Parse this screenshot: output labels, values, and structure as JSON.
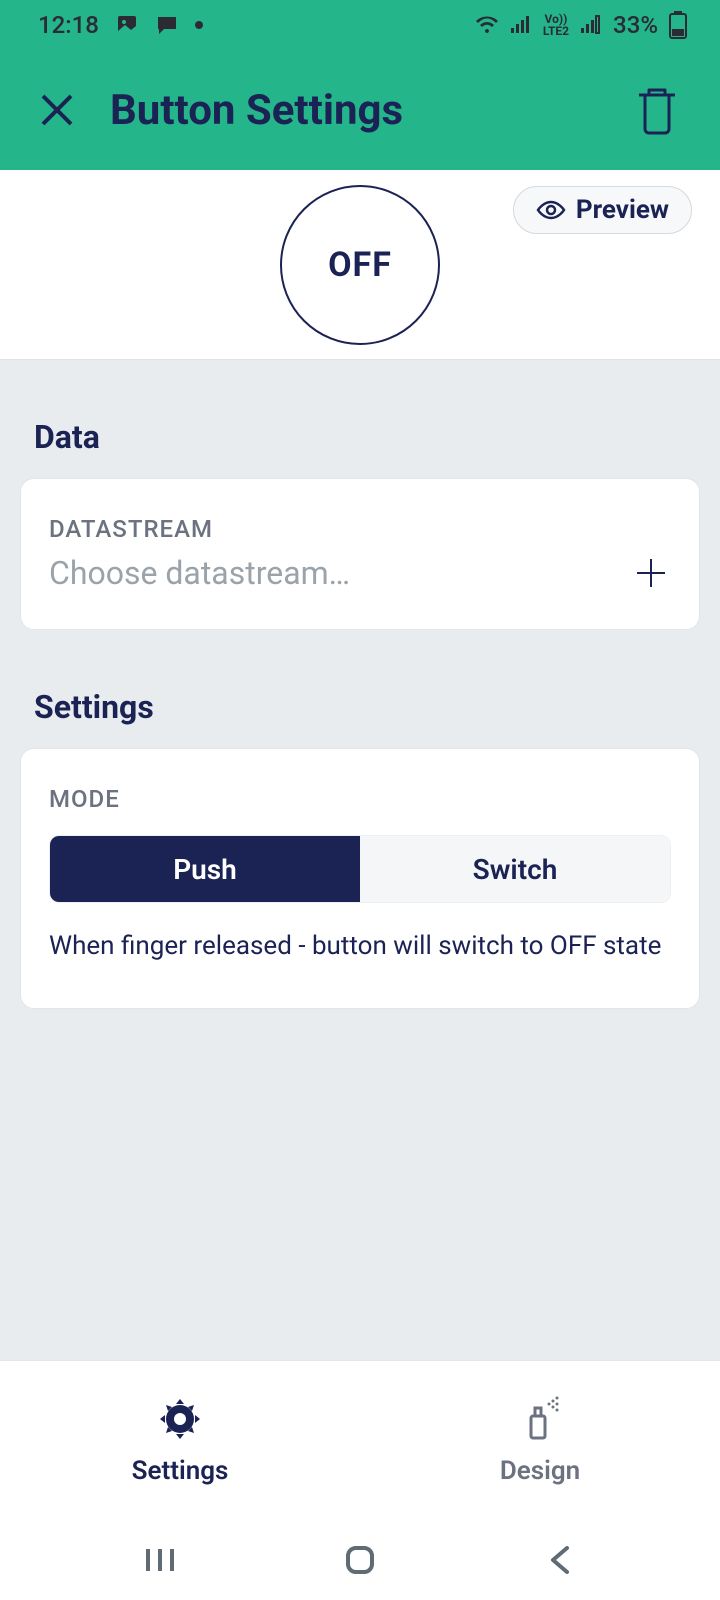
{
  "statusbar": {
    "time": "12:18",
    "battery": "33%",
    "network_label": "LTE2",
    "volte_label": "Vo))"
  },
  "header": {
    "title": "Button Settings"
  },
  "preview": {
    "button_state": "OFF",
    "preview_label": "Preview"
  },
  "data_section": {
    "title": "Data",
    "field_label": "DATASTREAM",
    "placeholder": "Choose datastream…"
  },
  "settings_section": {
    "title": "Settings",
    "mode_label": "MODE",
    "options": {
      "push": "Push",
      "switch": "Switch"
    },
    "description": "When finger released - button will switch to OFF state"
  },
  "tabs": {
    "settings": "Settings",
    "design": "Design"
  },
  "colors": {
    "accent": "#24b58a",
    "navy": "#1b2254"
  }
}
